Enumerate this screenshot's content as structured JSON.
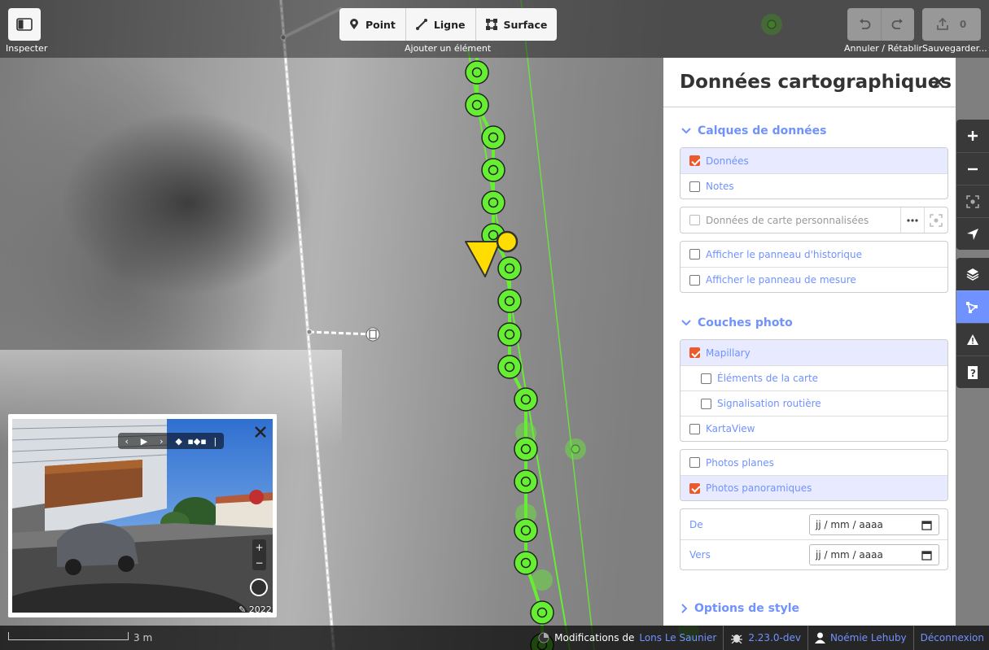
{
  "topbar": {
    "inspect_label": "Inspecter",
    "add": {
      "point": "Point",
      "line": "Ligne",
      "area": "Surface",
      "caption": "Ajouter un élément"
    },
    "undo_caption": "Annuler / Rétablir",
    "save_count": "0",
    "save_caption": "Sauvegarder..."
  },
  "panel": {
    "title": "Données cartographiques",
    "data_layers": {
      "heading": "Calques de données",
      "items": [
        {
          "label": "Données",
          "checked": true
        },
        {
          "label": "Notes",
          "checked": false
        }
      ],
      "custom_data": "Données de carte personnalisées",
      "history_panel": "Afficher le panneau d'historique",
      "measure_panel": "Afficher le panneau de mesure"
    },
    "photo_layers": {
      "heading": "Couches photo",
      "mapillary": "Mapillary",
      "map_features": "Éléments de la carte",
      "traffic_signs": "Signalisation routière",
      "kartaview": "KartaView",
      "flat_photos": "Photos planes",
      "panoramic_photos": "Photos panoramiques",
      "date_from_label": "De",
      "date_to_label": "Vers",
      "date_placeholder": "jj / mm / aaaa"
    },
    "style_options": "Options de style"
  },
  "photo_viewer": {
    "year": "2022"
  },
  "footer": {
    "scale": "3 m",
    "changes_prefix": "Modifications de",
    "changes_user": "Lons Le Saunier",
    "version": "2.23.0-dev",
    "user": "Noémie Lehuby",
    "logout": "Déconnexion"
  },
  "colors": {
    "accent": "#7092ff",
    "checkbox": "#ea5a2a",
    "vertex": "#66ee33",
    "selected": "#ffdd00"
  }
}
